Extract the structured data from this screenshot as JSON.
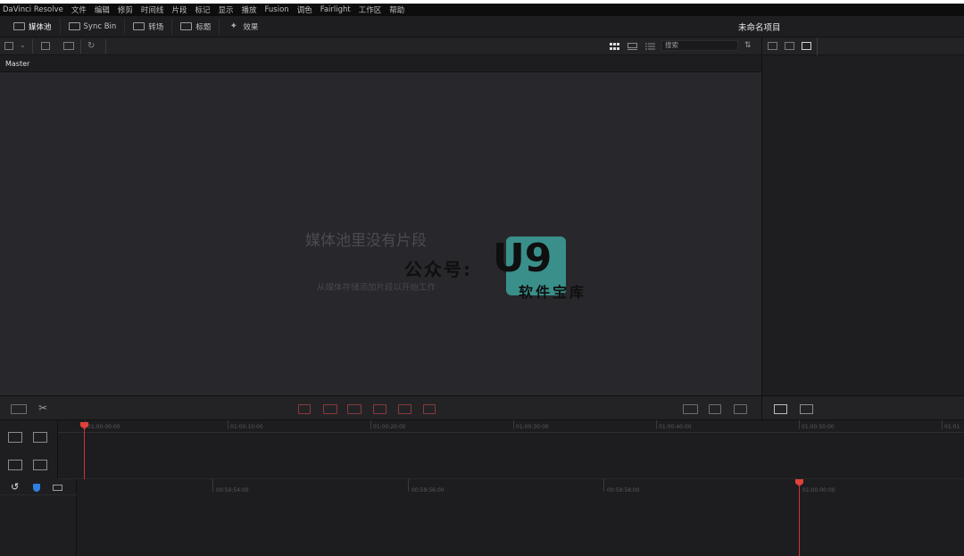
{
  "menu": [
    "DaVinci Resolve",
    "文件",
    "编辑",
    "修剪",
    "时间线",
    "片段",
    "标记",
    "显示",
    "播放",
    "Fusion",
    "调色",
    "Fairlight",
    "工作区",
    "帮助"
  ],
  "toolbar": {
    "media_pool": "媒体池",
    "sync_bin": "Sync Bin",
    "transitions": "转场",
    "titles": "标题",
    "effects": "效果"
  },
  "project_title": "未命名项目",
  "search": {
    "placeholder": "搜索"
  },
  "bin": {
    "master_label": "Master"
  },
  "empty_state": {
    "title": "媒体池里没有片段",
    "subtitle": "从媒体存储添加片段以开始工作"
  },
  "watermark": {
    "prefix": "公众号:",
    "logo": "U9",
    "sub": "软件宝库"
  },
  "timeline_upper": {
    "ticks": [
      "01:00:00:00",
      "01:00:10:00",
      "01:00:20:00",
      "01:00:30:00",
      "01:00:40:00",
      "01:00:50:00",
      "01:01"
    ]
  },
  "timeline_lower": {
    "ticks": [
      "00:59:54:00",
      "00:59:56:00",
      "00:59:58:00",
      "01:00:00:00"
    ]
  },
  "colors": {
    "accent_red": "#e0413a",
    "marker_blue": "#2f7fe0",
    "watermark_teal": "#3a8f8a"
  }
}
